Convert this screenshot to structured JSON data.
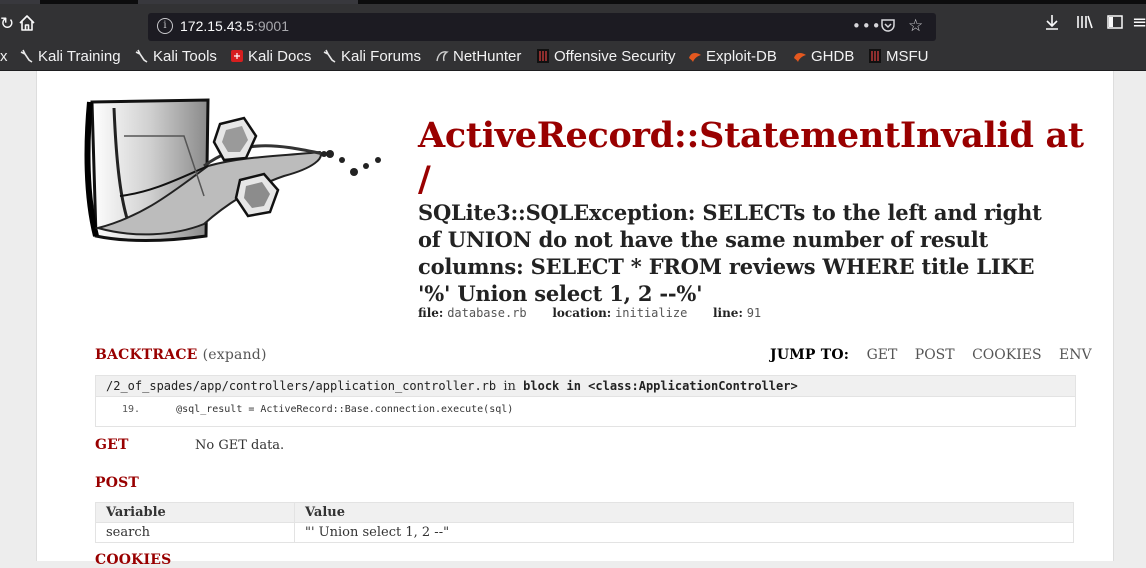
{
  "browser": {
    "url_host": "172.15.43.5",
    "url_port": ":9001",
    "bookmarks": [
      {
        "label": "Kali Training",
        "icon": "kali-dragon-icon"
      },
      {
        "label": "Kali Tools",
        "icon": "kali-dragon-icon"
      },
      {
        "label": "Kali Docs",
        "icon": "kali-docs-icon"
      },
      {
        "label": "Kali Forums",
        "icon": "kali-dragon-icon"
      },
      {
        "label": "NetHunter",
        "icon": "nethunter-icon"
      },
      {
        "label": "Offensive Security",
        "icon": "offsec-icon"
      },
      {
        "label": "Exploit-DB",
        "icon": "exploit-db-icon"
      },
      {
        "label": "GHDB",
        "icon": "ghdb-icon"
      },
      {
        "label": "MSFU",
        "icon": "offsec-icon"
      }
    ],
    "leading_bookmark_fragment": "x"
  },
  "error": {
    "title": "ActiveRecord::StatementInvalid at /",
    "message": "SQLite3::SQLException: SELECTs to the left and right of UNION do not have the same number of result columns: SELECT * FROM reviews WHERE title LIKE '%' Union select 1, 2 --%'",
    "file_label": "file:",
    "file_value": "database.rb",
    "location_label": "location:",
    "location_value": "initialize",
    "line_label": "line:",
    "line_value": "91"
  },
  "backtrace": {
    "heading": "BACKTRACE",
    "expand": "(expand)",
    "file_path": "/2_of_spades/app/controllers/application_controller.rb",
    "in_text": "in",
    "block_text": "block in <class:ApplicationController>",
    "line_number": "19.",
    "code": "      @sql_result = ActiveRecord::Base.connection.execute(sql)"
  },
  "jump_to": {
    "label": "JUMP TO:",
    "links": [
      "GET",
      "POST",
      "COOKIES",
      "ENV"
    ]
  },
  "get_section": {
    "heading": "GET",
    "empty_text": "No GET data."
  },
  "post_section": {
    "heading": "POST",
    "columns": [
      "Variable",
      "Value"
    ],
    "rows": [
      [
        "search",
        "\"' Union select 1, 2 --\""
      ]
    ]
  },
  "cookies_section": {
    "heading": "COOKIES"
  },
  "colors": {
    "accent_red": "#990000",
    "chrome_dark": "#323234"
  }
}
